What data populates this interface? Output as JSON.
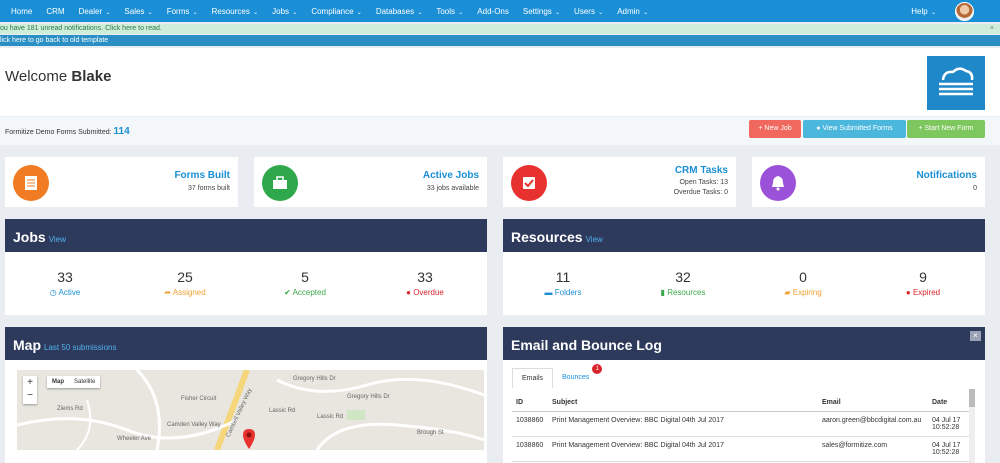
{
  "nav": {
    "items": [
      {
        "label": "Home",
        "chev": ""
      },
      {
        "label": "CRM",
        "chev": ""
      },
      {
        "label": "Dealer",
        "chev": "⌄"
      },
      {
        "label": "Sales",
        "chev": "⌄"
      },
      {
        "label": "Forms",
        "chev": "⌄"
      },
      {
        "label": "Resources",
        "chev": "⌄"
      },
      {
        "label": "Jobs",
        "chev": "⌄"
      },
      {
        "label": "Compliance",
        "chev": "⌄"
      },
      {
        "label": "Databases",
        "chev": "⌄"
      },
      {
        "label": "Tools",
        "chev": "⌄"
      },
      {
        "label": "Add-Ons",
        "chev": ""
      },
      {
        "label": "Settings",
        "chev": "⌄"
      },
      {
        "label": "Users",
        "chev": "⌄"
      },
      {
        "label": "Admin",
        "chev": "⌄"
      }
    ],
    "help": "Help",
    "help_chev": "⌄"
  },
  "notification": {
    "text": "ou have 181 unread notifications. Click here to read.",
    "close": "×"
  },
  "old_template": "lick here to go back to old template",
  "welcome": {
    "prefix": "Welcome",
    "name": "Blake"
  },
  "summary": {
    "label": "Formitize Demo Forms Submitted:",
    "count": "114"
  },
  "buttons": {
    "new_job": "+ New Job",
    "view_submitted": "● View Submitted Forms",
    "start_new": "+ Start New Form"
  },
  "cards": [
    {
      "title": "Forms Built",
      "lines": [
        "37 forms built"
      ],
      "color": "#f07b22",
      "icon": "document-icon"
    },
    {
      "title": "Active Jobs",
      "lines": [
        "33 jobs available"
      ],
      "color": "#2ea84a",
      "icon": "briefcase-icon"
    },
    {
      "title": "CRM Tasks",
      "lines": [
        "Open Tasks: 13",
        "Overdue Tasks: 0"
      ],
      "color": "#e8322f",
      "icon": "checkbox-icon"
    },
    {
      "title": "Notifications",
      "lines": [
        "0"
      ],
      "color": "#9b52d8",
      "icon": "bell-icon"
    }
  ],
  "jobs": {
    "title": "Jobs",
    "view": "View",
    "stats": [
      {
        "n": "33",
        "label": "Active",
        "icon": "◷",
        "color": "#1a8fd6"
      },
      {
        "n": "25",
        "label": "Assigned",
        "icon": "➦",
        "color": "#f0a030"
      },
      {
        "n": "5",
        "label": "Accepted",
        "icon": "✔",
        "color": "#3aa84a"
      },
      {
        "n": "33",
        "label": "Overdue",
        "icon": "●",
        "color": "#d9242b"
      }
    ]
  },
  "resources": {
    "title": "Resources",
    "view": "View",
    "stats": [
      {
        "n": "11",
        "label": "Folders",
        "icon": "▬",
        "color": "#1a8fd6"
      },
      {
        "n": "32",
        "label": "Resources",
        "icon": "▮",
        "color": "#3aa84a"
      },
      {
        "n": "0",
        "label": "Expiring",
        "icon": "▰",
        "color": "#f0a030"
      },
      {
        "n": "9",
        "label": "Expired",
        "icon": "●",
        "color": "#d9242b"
      }
    ]
  },
  "map": {
    "title": "Map",
    "sub": "Last 50 submissions",
    "map_btn": "Map",
    "sat_btn": "Satellite",
    "zoom_in": "+",
    "zoom_out": "−",
    "streets": [
      "Gregory Hills Dr",
      "Fisher Circuit",
      "Cambell Valley Way",
      "Lassic Rd",
      "Gregory Hills Dr",
      "Ziems Rd",
      "Camden Valley Way",
      "Lassic Rd",
      "Wheeler Ave",
      "Brough St"
    ]
  },
  "email": {
    "title": "Email and Bounce Log",
    "tabs": {
      "emails": "Emails",
      "bounces": "Bounces",
      "badge": "1"
    },
    "columns": [
      "ID",
      "Subject",
      "Email",
      "Date"
    ],
    "rows": [
      {
        "id": "1038860",
        "subject": "Print Management Overview: BBC Digital 04th Jul 2017",
        "email": "aaron.green@bbcdigital.com.au",
        "date": "04 Jul 17",
        "time": "10:52:28"
      },
      {
        "id": "1038860",
        "subject": "Print Management Overview: BBC Digital 04th Jul 2017",
        "email": "sales@formitize.com",
        "date": "04 Jul 17",
        "time": "10:52:28"
      }
    ]
  }
}
